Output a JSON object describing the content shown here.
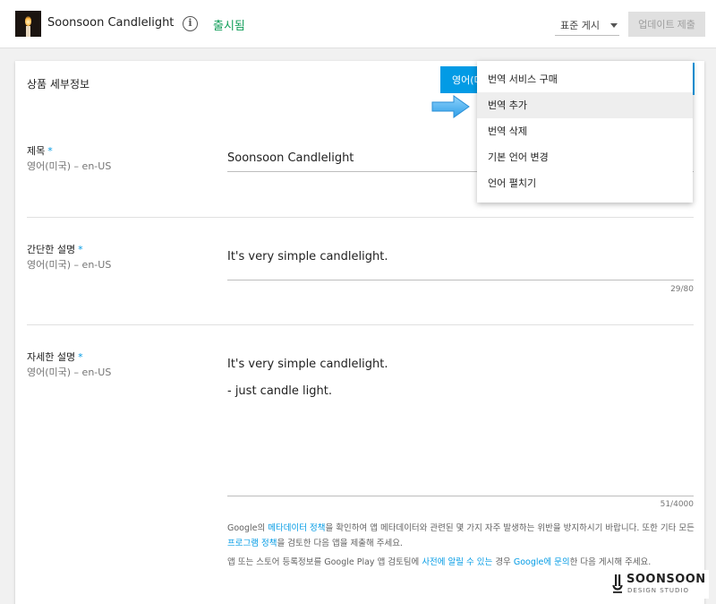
{
  "header": {
    "app_name": "Soonsoon Candlelight",
    "status": "출시됨",
    "publish_mode": "표준 게시",
    "submit_label": "업데이트 제출"
  },
  "card": {
    "title": "상품 세부정보",
    "language_button": "영어(미"
  },
  "fields": [
    {
      "label": "제목",
      "required": "*",
      "locale": "영어(미국) – en-US",
      "value": "Soonsoon Candlelight",
      "counter": ""
    },
    {
      "label": "간단한 설명",
      "required": "*",
      "locale": "영어(미국) – en-US",
      "value": "It's very simple candlelight.",
      "counter": "29/80"
    },
    {
      "label": "자세한 설명",
      "required": "*",
      "locale": "영어(미국) – en-US",
      "value_line1": "It's very simple candlelight.",
      "value_line2": "- just candle light.",
      "counter": "51/4000"
    }
  ],
  "notice": {
    "p1_a": "Google의 ",
    "p1_link1": "메타데이터 정책",
    "p1_b": "을 확인하여 앱 메타데이터와 관련된 몇 가지 자주 발생하는 위반을 방지하시기 바랍니다. 또한 기타 모든 ",
    "p1_link2": "프로그램 정책",
    "p1_c": "을 검토한 다음 앱을 제출해 주세요.",
    "p2_a": "앱 또는 스토어 등록정보를 Google Play 앱 검토팀에 ",
    "p2_link1": "사전에 알릴 수 있는",
    "p2_b": " 경우 ",
    "p2_link2": "Google에 문의",
    "p2_c": "한 다음 게시해 주세요."
  },
  "menu": {
    "items": [
      "번역 서비스 구매",
      "번역 추가",
      "번역 삭제",
      "기본 언어 변경",
      "언어 펼치기"
    ],
    "highlighted": "번역 추가"
  },
  "watermark": {
    "name": "SOONSOON",
    "tagline": "DESIGN STUDIO"
  },
  "colors": {
    "accent": "#039be5",
    "status_green": "#0f9d58",
    "arrow": "#4fb3f0"
  }
}
